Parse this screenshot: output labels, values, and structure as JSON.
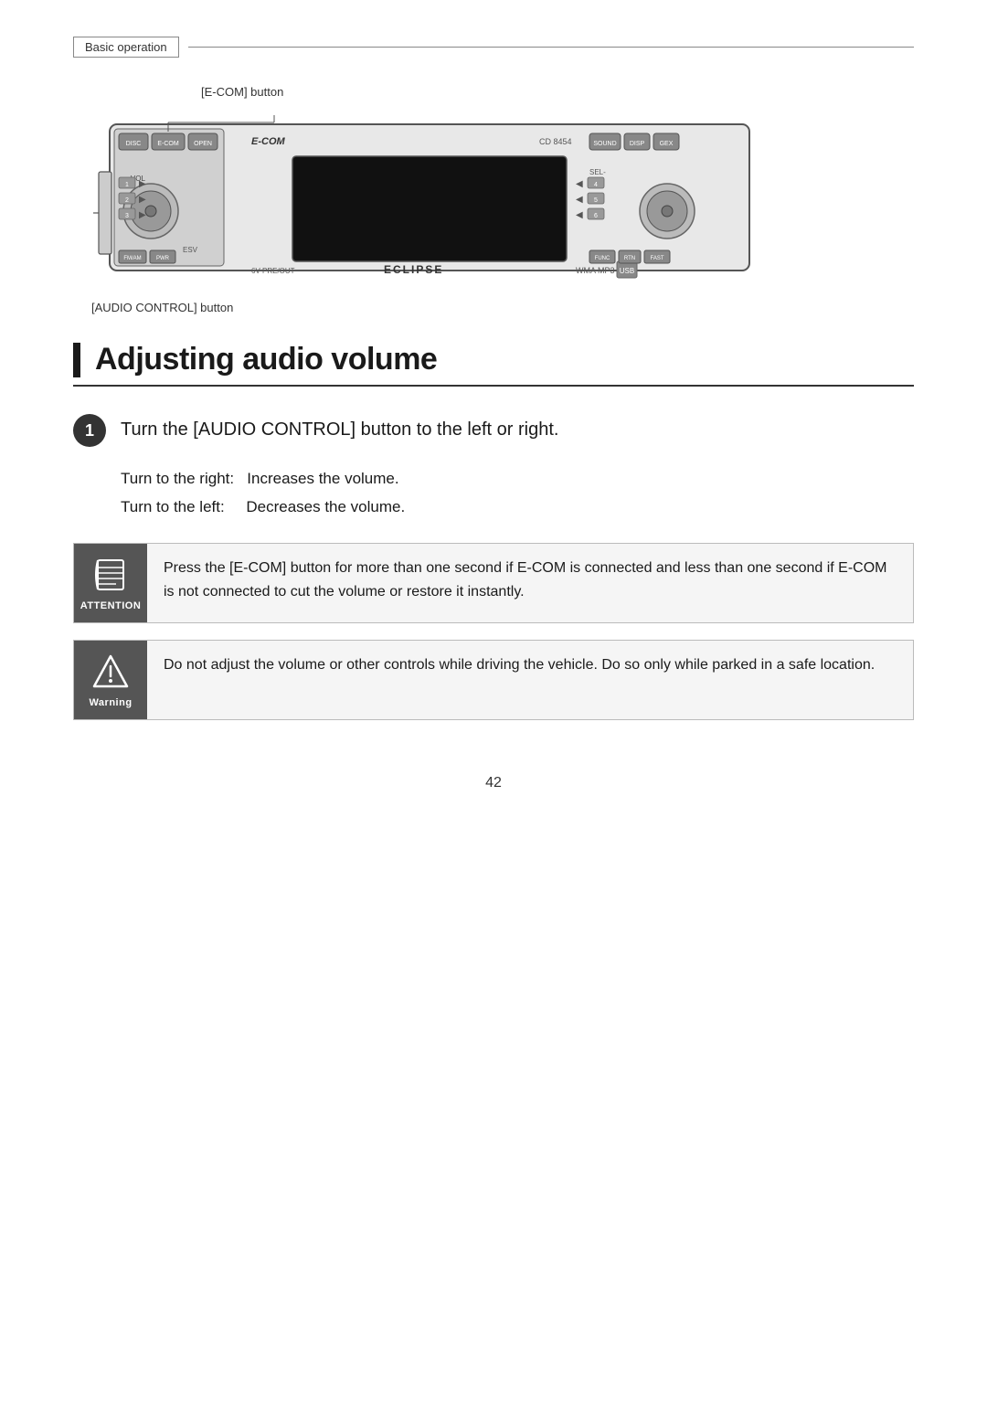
{
  "breadcrumb": {
    "label": "Basic operation"
  },
  "diagram": {
    "ecom_button_label": "[E-COM] button",
    "audio_control_label": "[AUDIO CONTROL] button"
  },
  "section": {
    "heading": "Adjusting audio volume"
  },
  "step1": {
    "number": "1",
    "text": "Turn the [AUDIO CONTROL] button to the left or right."
  },
  "turn_info": {
    "right_label": "Turn to the right:",
    "right_value": "Increases the volume.",
    "left_label": "Turn to the left:",
    "left_value": "Decreases the volume."
  },
  "attention_box": {
    "label": "ATTENTION",
    "text": "Press the [E-COM] button for more than one second if E-COM is connected and less than one second if E-COM is not connected to cut the volume or restore it instantly."
  },
  "warning_box": {
    "label": "Warning",
    "text": "Do not adjust the volume or other controls while driving the vehicle. Do so only while parked in a safe location."
  },
  "page_number": "42"
}
